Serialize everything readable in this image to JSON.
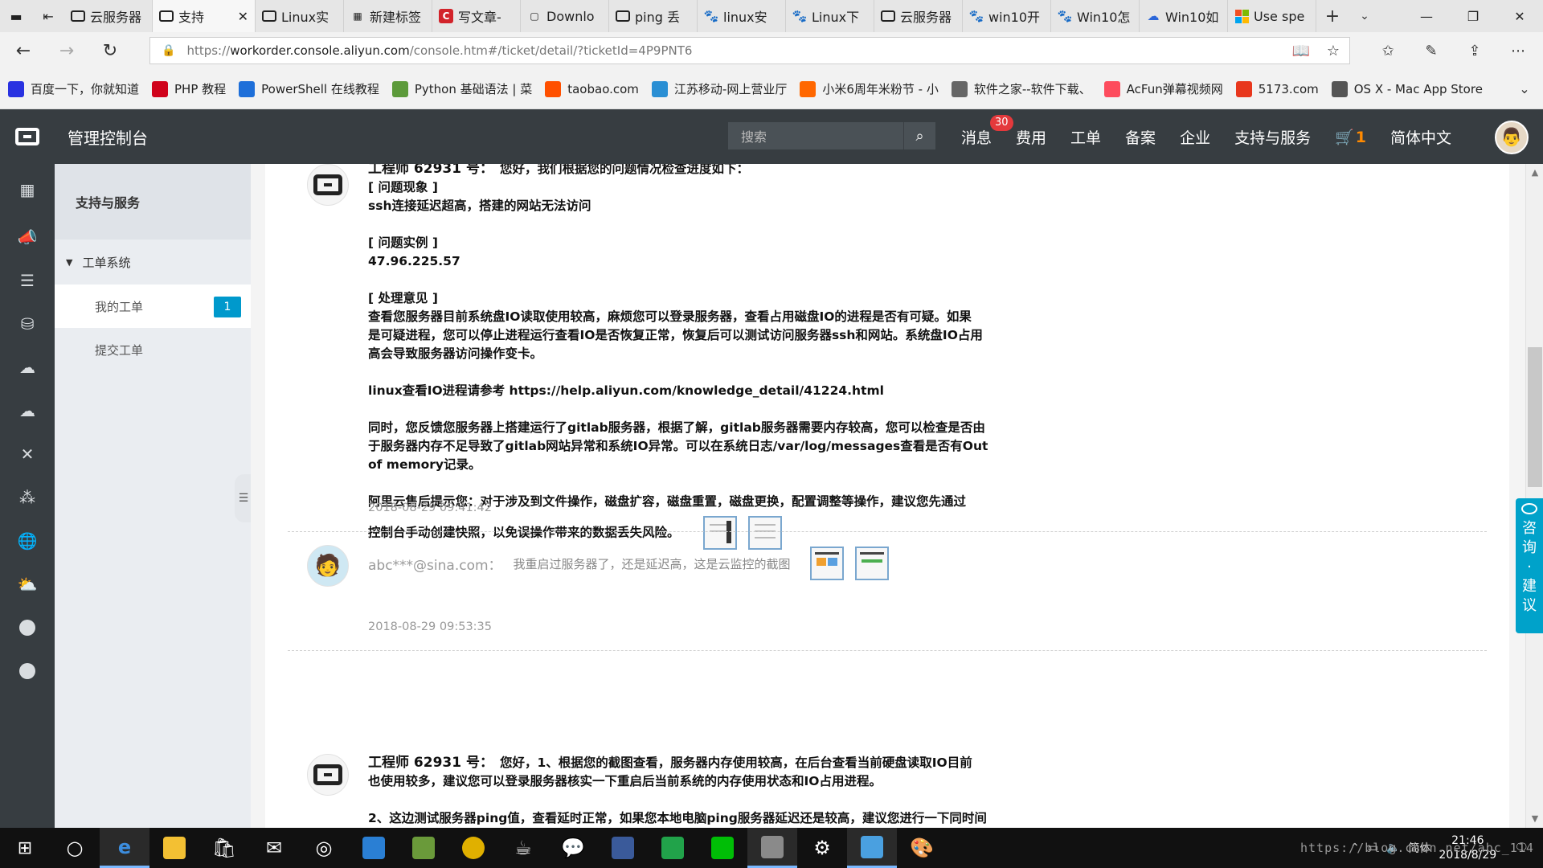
{
  "browser": {
    "tabs": [
      {
        "label": "云服务器",
        "favicon": "aliyun-icon"
      },
      {
        "label": "支持",
        "favicon": "aliyun-icon",
        "active": true
      },
      {
        "label": "Linux实",
        "favicon": "aliyun-icon"
      },
      {
        "label": "新建标签",
        "favicon": "newtab-icon"
      },
      {
        "label": "写文章-",
        "favicon": "csdn-icon"
      },
      {
        "label": "Downlo",
        "favicon": "doc-icon"
      },
      {
        "label": "ping 丢",
        "favicon": "aliyun-icon"
      },
      {
        "label": "linux安",
        "favicon": "baidu-paw-icon"
      },
      {
        "label": "Linux下",
        "favicon": "baidu-paw-icon"
      },
      {
        "label": "云服务器",
        "favicon": "aliyun-icon"
      },
      {
        "label": "win10开",
        "favicon": "baidu-paw-icon"
      },
      {
        "label": "Win10怎",
        "favicon": "baidu-paw-icon"
      },
      {
        "label": "Win10如",
        "favicon": "edge-cloud-icon"
      },
      {
        "label": "Use spe",
        "favicon": "microsoft-icon"
      }
    ],
    "url": {
      "scheme": "https://",
      "host": "workorder.console.aliyun.com",
      "path": "/console.htm#/ticket/detail/?ticketId=4P9PNT6"
    },
    "favorites": [
      {
        "label": "百度一下，你就知道",
        "color": "#2932e1"
      },
      {
        "label": "PHP 教程",
        "color": "#d0021b"
      },
      {
        "label": "PowerShell 在线教程",
        "color": "#1e6fd9"
      },
      {
        "label": "Python 基础语法 | 菜",
        "color": "#5c9a3a"
      },
      {
        "label": "taobao.com",
        "color": "#ff5000"
      },
      {
        "label": "江苏移动-网上营业厅",
        "color": "#2a8fd4"
      },
      {
        "label": "小米6周年米粉节 - 小",
        "color": "#ff6700"
      },
      {
        "label": "软件之家--软件下载、",
        "color": "#666666"
      },
      {
        "label": "AcFun弹幕视频网",
        "color": "#fd4c5d"
      },
      {
        "label": "5173.com",
        "color": "#e8371d"
      },
      {
        "label": "OS X - Mac App Store",
        "color": "#555555"
      }
    ]
  },
  "console": {
    "title": "管理控制台",
    "search_placeholder": "搜索",
    "menu": {
      "messages": "消息",
      "messages_badge": "30",
      "billing": "费用",
      "ticket": "工单",
      "icp": "备案",
      "enterprise": "企业",
      "support": "支持与服务",
      "cart_count": "1",
      "language": "简体中文"
    }
  },
  "sidebar": {
    "title": "支持与服务",
    "group": "工单系统",
    "items": [
      {
        "label": "我的工单",
        "count": "1"
      },
      {
        "label": "提交工单"
      }
    ]
  },
  "messages": [
    {
      "sender": "工程师 62931 号：",
      "lines": [
        "您好，我们根据您的问题情况检查进度如下：",
        "[ 问题现象 ]",
        "ssh连接延迟超高，搭建的网站无法访问",
        "",
        "[ 问题实例 ]",
        "47.96.225.57",
        "",
        "[ 处理意见 ]",
        "查看您服务器目前系统盘IO读取使用较高，麻烦您可以登录服务器，查看占用磁盘IO的进程是否有可疑。如果",
        "是可疑进程，您可以停止进程运行查看IO是否恢复正常，恢复后可以测试访问服务器ssh和网站。系统盘IO占用",
        "高会导致服务器访问操作变卡。",
        "",
        "linux查看IO进程请参考 https://help.aliyun.com/knowledge_detail/41224.html",
        "",
        "同时，您反馈您服务器上搭建运行了gitlab服务器，根据了解，gitlab服务器需要内存较高，您可以检查是否由",
        "于服务器内存不足导致了gitlab网站异常和系统IO异常。可以在系统日志/var/log/messages查看是否有Out",
        "of memory记录。",
        "",
        " 阿里云售后提示您：对于涉及到文件操作，磁盘扩容，磁盘重置，磁盘更换，配置调整等操作，建议您先通过"
      ],
      "last_line": "控制台手动创建快照，以免误操作带来的数据丢失风险。",
      "time": "2018-08-29 09:41:42"
    },
    {
      "sender": "abc***@sina.com：",
      "text": "我重启过服务器了，还是延迟高，这是云监控的截图",
      "time": "2018-08-29 09:53:35"
    },
    {
      "sender": "工程师 62931 号：",
      "lines": [
        "您好，1、根据您的截图查看，服务器内存使用较高，在后台查看当前硬盘读取IO目前",
        "也使用较多，建议您可以登录服务器核实一下重启后当前系统的内存使用状态和IO占用进程。",
        "",
        "2、这边测试服务器ping值，查看延时正常，如果您本地电脑ping服务器延迟还是较高，建议您进行一下同时间"
      ]
    }
  ],
  "consult": [
    "咨",
    "询",
    "·",
    "建",
    "议"
  ],
  "taskbar": {
    "ime": "简体",
    "time": "21:46",
    "date": "2018/8/29"
  },
  "watermark": "https://blog.csdn.net/abc_114",
  "colors": {
    "console_bar": "#373d41",
    "badge_red": "#e4393c",
    "count_blue": "#0099cc",
    "consult_blue": "#00a2ca"
  }
}
